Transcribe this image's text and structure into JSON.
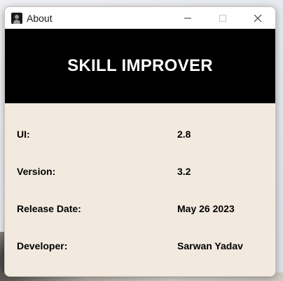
{
  "window": {
    "title": "About",
    "icon": "app-avatar-icon",
    "controls": {
      "minimize_icon": "minimize-icon",
      "maximize_icon": "maximize-icon",
      "close_icon": "close-icon"
    }
  },
  "header": {
    "title": "SKILL IMPROVER",
    "background": "#000000",
    "text_color": "#ffffff"
  },
  "info": {
    "rows": [
      {
        "label": "UI:",
        "value": "2.8"
      },
      {
        "label": "Version:",
        "value": "3.2"
      },
      {
        "label": "Release Date:",
        "value": "May 26 2023"
      },
      {
        "label": "Developer:",
        "value": "Sarwan Yadav"
      }
    ],
    "background": "#f3eadf"
  }
}
